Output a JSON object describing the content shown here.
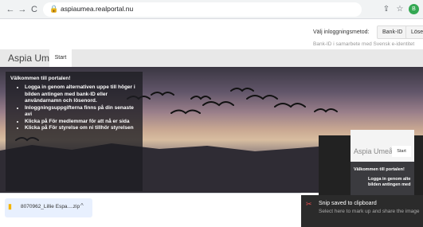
{
  "browser": {
    "url": "aspiaumea.realportal.nu",
    "profile_initial": "B",
    "icons": [
      "back-icon",
      "forward-icon",
      "reload-icon",
      "lock-icon",
      "share-icon",
      "star-icon"
    ]
  },
  "login": {
    "label": "Välj inloggningsmetod:",
    "bankid": "Bank-ID",
    "password": "Lösen",
    "hint": "Bank-ID i samarbete med Svensk e-identitet"
  },
  "site": {
    "name": "Aspia Umeå",
    "tab": "Start"
  },
  "welcome": {
    "title": "Välkommen till portalen!",
    "items": [
      "Logga in genom alternativen uppe till höger i bilden antingen med bank-ID eller användarnamn och lösenord.",
      "Inloggningsuppgifterna finns på din senaste avi",
      "Klicka på För medlemmar för att nå er sida",
      "Klicka på För styrelse om ni tillhör styrelsen"
    ]
  },
  "preview": {
    "name": "Aspia Umeå",
    "tab": "Start",
    "title": "Välkommen till portalen!",
    "line1": "Logga in genom alte",
    "line2": "bilden antingen med"
  },
  "toast": {
    "title": "Snip saved to clipboard",
    "body": "Select here to mark up and share the image"
  },
  "download": {
    "filename": "8070962_Lillie Espa....zip"
  },
  "colors": {
    "accent": "#34a853",
    "overlay": "#1e1e23"
  }
}
